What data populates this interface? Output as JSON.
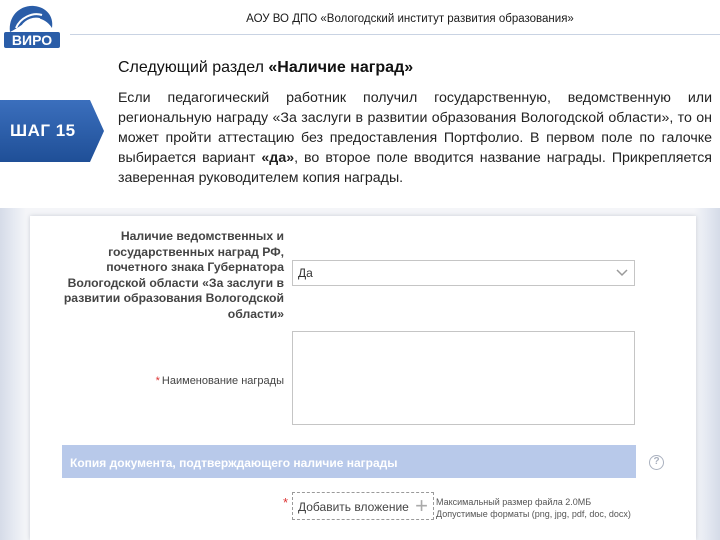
{
  "header": {
    "logo_text": "ВИРО",
    "title": "АОУ ВО ДПО «Вологодский институт развития образования»"
  },
  "section": {
    "heading_prefix": "Следующий раздел",
    "heading_name": "«Наличие наград»"
  },
  "step": {
    "label": "ШАГ 15"
  },
  "description": {
    "part1": "Если педагогический работник получил государственную, ведомственную или региональную награду «За заслуги в развитии образования Вологодской области», то он может пройти аттестацию без предоставления Портфолио. В первом поле по галочке выбирается вариант ",
    "bold": "«да»",
    "part2": ", во второе поле вводится название награды. Прикрепляется заверенная руководителем копия награды."
  },
  "form": {
    "award_label": "Наличие ведомственных и государственных наград РФ, почетного знака Губернатора Вологодской области «За заслуги в развитии образования Вологодской области»",
    "award_value": "Да",
    "name_label": "Наименование награды",
    "required_mark": "*",
    "doc_section_title": "Копия документа, подтверждающего наличие награды",
    "help_symbol": "?",
    "attach_label": "Добавить вложение",
    "attach_plus": "+",
    "file_max_size": "Максимальный размер файла 2.0МБ",
    "file_formats": "Допустимые форматы (png, jpg, pdf, doc, docx)"
  },
  "colors": {
    "accent_blue": "#2a5da8",
    "section_bar": "#b8c9ea",
    "required_red": "#d33333"
  }
}
